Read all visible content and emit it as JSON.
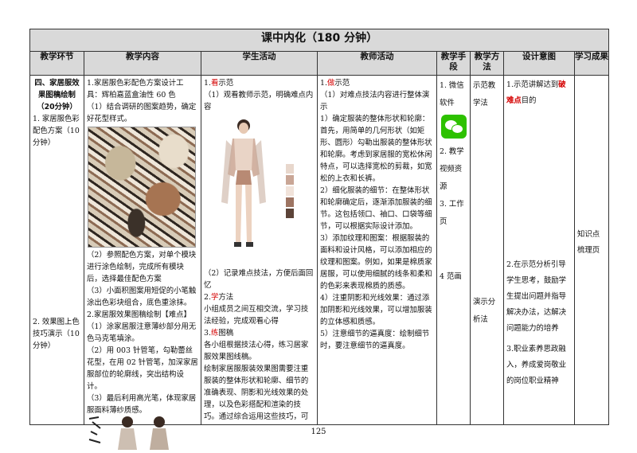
{
  "title": "课中内化（180 分钟）",
  "headers": [
    "教学环节",
    "教学内容",
    "学生活动",
    "教师活动",
    "教学手段",
    "教学方法",
    "设计意图",
    "学习成果"
  ],
  "col1": {
    "section_title": "四、家居服效果图稿绘制（20分钟）",
    "item1": "1. 家居服色彩配色方案（10分钟）",
    "item2": "2. 效果图上色技巧演示（10分钟）"
  },
  "col2": {
    "l1": "1.家居服色彩配色方案设计工具：辉柏嘉蓝盒油性 60 色",
    "l2": "（1）结合调研的图案趋势，确定好花型样式。",
    "l3": "（2）参照配色方案，对单个模块进行涂色绘制，完成所有模块后，选择最佳配色方案",
    "l4": "（3）小面积图案用短促的小笔触涂出色彩块组合，底色重涂抹。",
    "l5": "2.家居服效果图稿绘制【难点】",
    "l6": "（1）涂家居服注意薄纱部分用无色马克笔填涂。",
    "l7": "（2）用 003 针管笔，勾勒蕾丝花型，在用 02 针管笔，加深家居服部位的轮廓线，突出结构设计。",
    "l8": "（3）最后利用高光笔，体现家居服面料薄纱质感。"
  },
  "col3": {
    "a_num": "1.",
    "a_red": "看",
    "a_rest": "示范",
    "a1": "（1）观看教师示范，明确难点内容",
    "a2": "（2）记录难点技法，方便后面回忆",
    "b_num": "2.",
    "b_red": "学",
    "b_rest": "方法",
    "b1": "小组成员之间互相交流，学习技法经验，完成观看心得",
    "c_num": "3.",
    "c_red": "练",
    "c_rest": "图稿",
    "c1": "各小组根据技法心得，练习居家服效果图线稿。",
    "c2": "绘制家居服服装效果图需要注重服装的整体形状和轮廓、细节的准确表现、阴影和光线效果的处理，以及色彩搭配和渲染的技巧。通过综合运用这些技巧，可"
  },
  "col4": {
    "a_num": "1.",
    "a_red": "做",
    "a_rest": "示范",
    "t1": "（1）对难点技法内容进行整体演示",
    "t2": "1）确定服装的整体形状和轮廓：首先，用简单的几何形状（如矩形、圆形）勾勒出服装的整体形状和轮廓。考虑到家居服的宽松休闲特点，可以选择宽松的剪裁，如宽松的上衣和长裤。",
    "t3": "2）细化服装的细节：在整体形状和轮廓确定后，逐渐添加服装的细节。这包括领口、袖口、口袋等细节，可以根据实际设计添加。",
    "t4": "3）添加纹理和图案：根据服装的面料和设计风格，可以添加相应的纹理和图案。例如，如果是棉质家居服，可以使用细腻的线条和柔和的色彩来表现棉质的质感。",
    "t5": "4）注重阴影和光线效果：通过添加阴影和光线效果，可以增加服装的立体感和质感。",
    "t6": "5）注意细节的逼真度：绘制细节时，要注意细节的逼真度。"
  },
  "col5": {
    "m1": "1. 微信软件",
    "m2": "2. 教学视频资源",
    "m3": "3. 工作页",
    "m4": "4 范画"
  },
  "col6": {
    "w1": "示范教学法",
    "w2": "演示分析法"
  },
  "col7": {
    "d1_a": "1.示范讲解达到",
    "d1_red": "破难点",
    "d1_b": "目的",
    "d2": "2.在示范分析引导学生思考，鼓励学生提出问题并指导解决办法，达解决问题能力的培养",
    "d3": "3.职业素养思政融入，养成爱岗敬业的岗位职业精神"
  },
  "col8": {
    "r1": "知识点梳理页"
  },
  "page_number": "125",
  "colors": {
    "header_bg": "#d9d9d9",
    "accent_red": "#d40000",
    "wechat_green": "#2dc100"
  }
}
